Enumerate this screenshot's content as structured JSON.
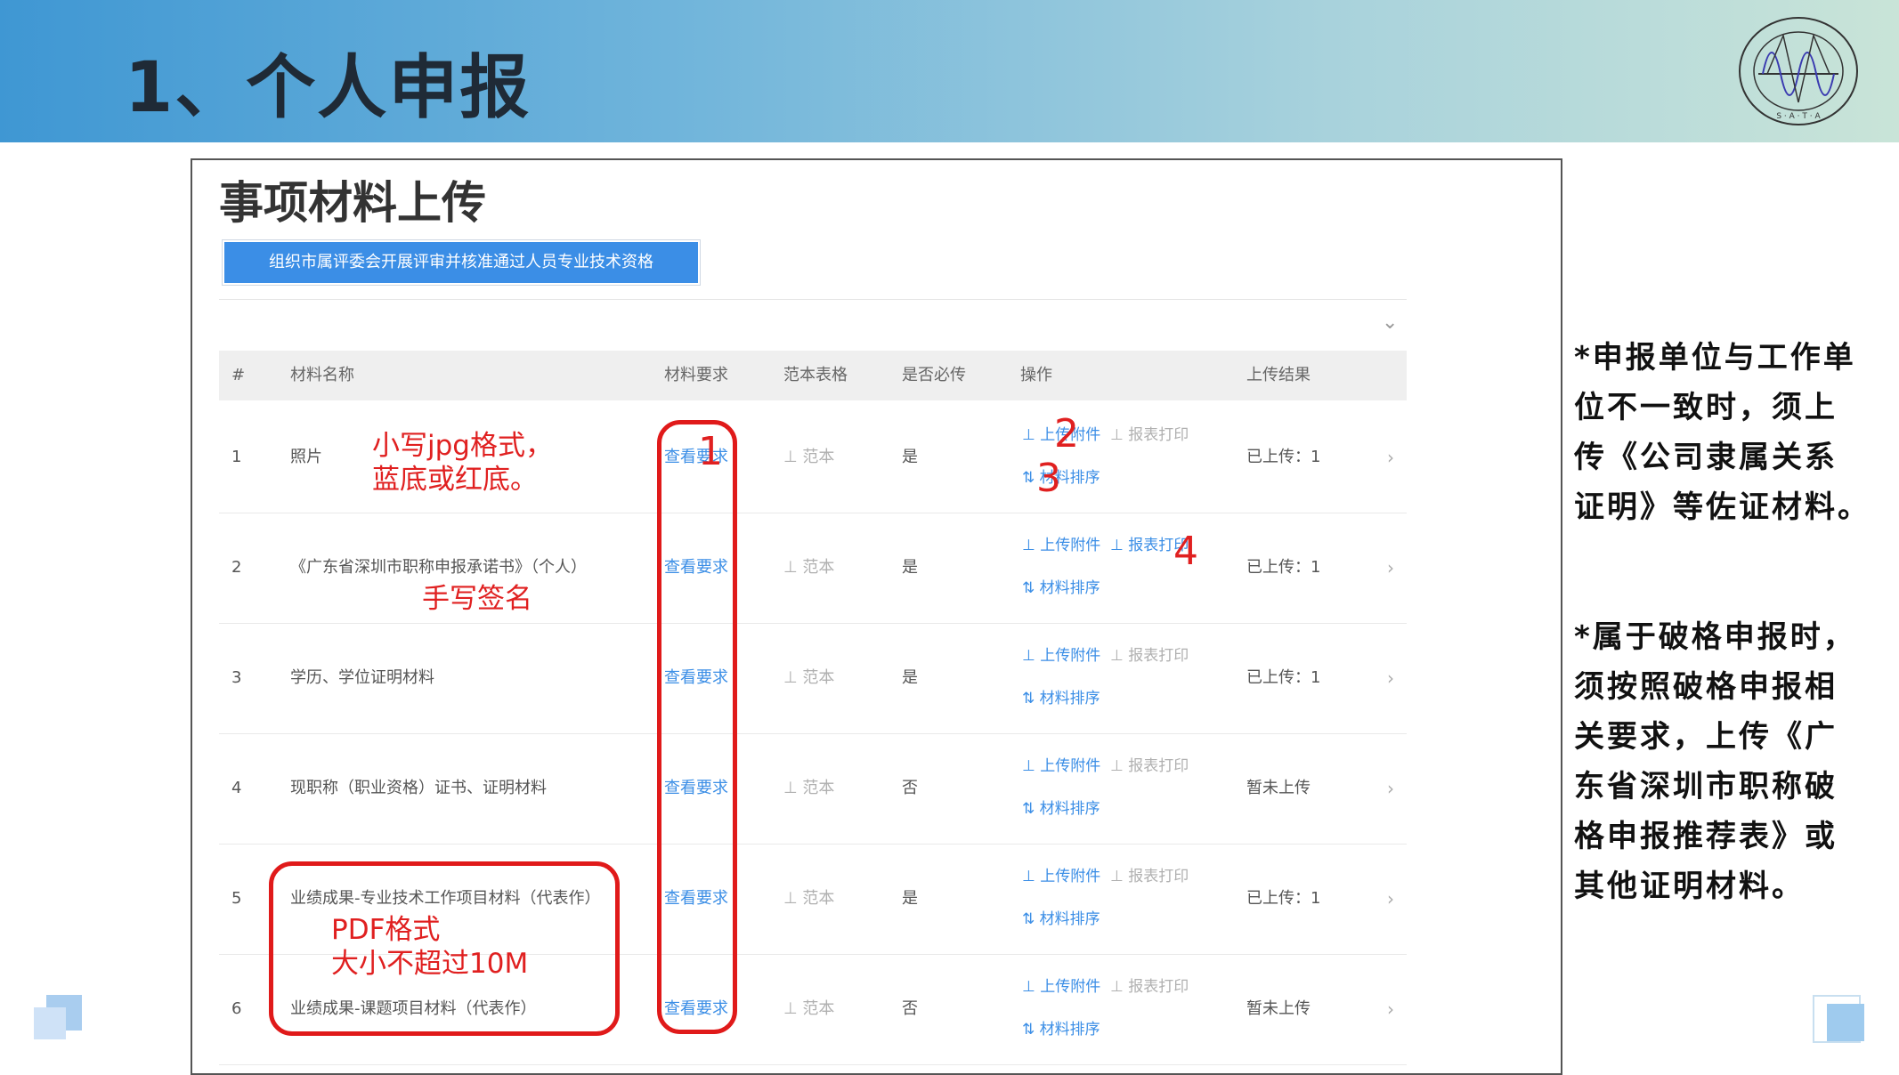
{
  "slide": {
    "title": "1、个人申报",
    "logo_text": "SHENZHEN ASSOCIATION OF TESTERS AND ANALYSIS · S · A · T · A"
  },
  "screenshot": {
    "title": "事项材料上传",
    "tab_label": "组织市属评委会开展评审并核准通过人员专业技术资格",
    "columns": [
      "#",
      "材料名称",
      "材料要求",
      "范本表格",
      "是否必传",
      "操作",
      "上传结果"
    ],
    "rows": [
      {
        "no": "1",
        "name": "照片",
        "req": "查看要求",
        "sample": "⊥ 范本",
        "required": "是",
        "op_upload": "上传附件",
        "op_print": "报表打印",
        "op_sort": "材料排序",
        "result": "已上传：1"
      },
      {
        "no": "2",
        "name": "《广东省深圳市职称申报承诺书》（个人）",
        "req": "查看要求",
        "sample": "⊥ 范本",
        "required": "是",
        "op_upload": "上传附件",
        "op_print": "报表打印",
        "op_sort": "材料排序",
        "result": "已上传：1"
      },
      {
        "no": "3",
        "name": "学历、学位证明材料",
        "req": "查看要求",
        "sample": "⊥ 范本",
        "required": "是",
        "op_upload": "上传附件",
        "op_print": "报表打印",
        "op_sort": "材料排序",
        "result": "已上传：1"
      },
      {
        "no": "4",
        "name": "现职称（职业资格）证书、证明材料",
        "req": "查看要求",
        "sample": "⊥ 范本",
        "required": "否",
        "op_upload": "上传附件",
        "op_print": "报表打印",
        "op_sort": "材料排序",
        "result": "暂未上传"
      },
      {
        "no": "5",
        "name": "业绩成果-专业技术工作项目材料（代表作）",
        "req": "查看要求",
        "sample": "⊥ 范本",
        "required": "是",
        "op_upload": "上传附件",
        "op_print": "报表打印",
        "op_sort": "材料排序",
        "result": "已上传：1"
      },
      {
        "no": "6",
        "name": "业绩成果-课题项目材料（代表作）",
        "req": "查看要求",
        "sample": "⊥ 范本",
        "required": "否",
        "op_upload": "上传附件",
        "op_print": "报表打印",
        "op_sort": "材料排序",
        "result": "暂未上传"
      }
    ]
  },
  "annotations": {
    "photo_note_1": "小写jpg格式，",
    "photo_note_2": "蓝底或红底。",
    "sign_note": "手写签名",
    "pdf_note_1": "PDF格式",
    "pdf_note_2": "大小不超过10M",
    "num1": "1",
    "num2": "2",
    "num3": "3",
    "num4": "4",
    "color": "#e02020"
  },
  "side_notes": {
    "note1": [
      "*申报单位与工作单",
      "位不一致时，须上",
      "传《公司隶属关系",
      "证明》等佐证材料。"
    ],
    "note2": [
      "*属于破格申报时，",
      "须按照破格申报相",
      "关要求，上传《广",
      "东省深圳市职称破",
      "格申报推荐表》或",
      "其他证明材料。"
    ]
  }
}
